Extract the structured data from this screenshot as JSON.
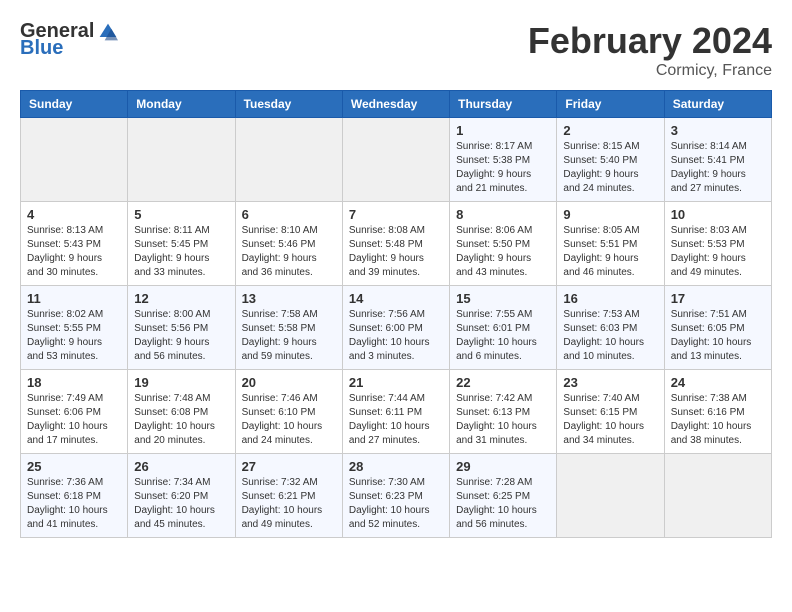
{
  "header": {
    "logo_general": "General",
    "logo_blue": "Blue",
    "month": "February 2024",
    "location": "Cormicy, France"
  },
  "days_of_week": [
    "Sunday",
    "Monday",
    "Tuesday",
    "Wednesday",
    "Thursday",
    "Friday",
    "Saturday"
  ],
  "weeks": [
    [
      {
        "day": "",
        "info": ""
      },
      {
        "day": "",
        "info": ""
      },
      {
        "day": "",
        "info": ""
      },
      {
        "day": "",
        "info": ""
      },
      {
        "day": "1",
        "info": "Sunrise: 8:17 AM\nSunset: 5:38 PM\nDaylight: 9 hours\nand 21 minutes."
      },
      {
        "day": "2",
        "info": "Sunrise: 8:15 AM\nSunset: 5:40 PM\nDaylight: 9 hours\nand 24 minutes."
      },
      {
        "day": "3",
        "info": "Sunrise: 8:14 AM\nSunset: 5:41 PM\nDaylight: 9 hours\nand 27 minutes."
      }
    ],
    [
      {
        "day": "4",
        "info": "Sunrise: 8:13 AM\nSunset: 5:43 PM\nDaylight: 9 hours\nand 30 minutes."
      },
      {
        "day": "5",
        "info": "Sunrise: 8:11 AM\nSunset: 5:45 PM\nDaylight: 9 hours\nand 33 minutes."
      },
      {
        "day": "6",
        "info": "Sunrise: 8:10 AM\nSunset: 5:46 PM\nDaylight: 9 hours\nand 36 minutes."
      },
      {
        "day": "7",
        "info": "Sunrise: 8:08 AM\nSunset: 5:48 PM\nDaylight: 9 hours\nand 39 minutes."
      },
      {
        "day": "8",
        "info": "Sunrise: 8:06 AM\nSunset: 5:50 PM\nDaylight: 9 hours\nand 43 minutes."
      },
      {
        "day": "9",
        "info": "Sunrise: 8:05 AM\nSunset: 5:51 PM\nDaylight: 9 hours\nand 46 minutes."
      },
      {
        "day": "10",
        "info": "Sunrise: 8:03 AM\nSunset: 5:53 PM\nDaylight: 9 hours\nand 49 minutes."
      }
    ],
    [
      {
        "day": "11",
        "info": "Sunrise: 8:02 AM\nSunset: 5:55 PM\nDaylight: 9 hours\nand 53 minutes."
      },
      {
        "day": "12",
        "info": "Sunrise: 8:00 AM\nSunset: 5:56 PM\nDaylight: 9 hours\nand 56 minutes."
      },
      {
        "day": "13",
        "info": "Sunrise: 7:58 AM\nSunset: 5:58 PM\nDaylight: 9 hours\nand 59 minutes."
      },
      {
        "day": "14",
        "info": "Sunrise: 7:56 AM\nSunset: 6:00 PM\nDaylight: 10 hours\nand 3 minutes."
      },
      {
        "day": "15",
        "info": "Sunrise: 7:55 AM\nSunset: 6:01 PM\nDaylight: 10 hours\nand 6 minutes."
      },
      {
        "day": "16",
        "info": "Sunrise: 7:53 AM\nSunset: 6:03 PM\nDaylight: 10 hours\nand 10 minutes."
      },
      {
        "day": "17",
        "info": "Sunrise: 7:51 AM\nSunset: 6:05 PM\nDaylight: 10 hours\nand 13 minutes."
      }
    ],
    [
      {
        "day": "18",
        "info": "Sunrise: 7:49 AM\nSunset: 6:06 PM\nDaylight: 10 hours\nand 17 minutes."
      },
      {
        "day": "19",
        "info": "Sunrise: 7:48 AM\nSunset: 6:08 PM\nDaylight: 10 hours\nand 20 minutes."
      },
      {
        "day": "20",
        "info": "Sunrise: 7:46 AM\nSunset: 6:10 PM\nDaylight: 10 hours\nand 24 minutes."
      },
      {
        "day": "21",
        "info": "Sunrise: 7:44 AM\nSunset: 6:11 PM\nDaylight: 10 hours\nand 27 minutes."
      },
      {
        "day": "22",
        "info": "Sunrise: 7:42 AM\nSunset: 6:13 PM\nDaylight: 10 hours\nand 31 minutes."
      },
      {
        "day": "23",
        "info": "Sunrise: 7:40 AM\nSunset: 6:15 PM\nDaylight: 10 hours\nand 34 minutes."
      },
      {
        "day": "24",
        "info": "Sunrise: 7:38 AM\nSunset: 6:16 PM\nDaylight: 10 hours\nand 38 minutes."
      }
    ],
    [
      {
        "day": "25",
        "info": "Sunrise: 7:36 AM\nSunset: 6:18 PM\nDaylight: 10 hours\nand 41 minutes."
      },
      {
        "day": "26",
        "info": "Sunrise: 7:34 AM\nSunset: 6:20 PM\nDaylight: 10 hours\nand 45 minutes."
      },
      {
        "day": "27",
        "info": "Sunrise: 7:32 AM\nSunset: 6:21 PM\nDaylight: 10 hours\nand 49 minutes."
      },
      {
        "day": "28",
        "info": "Sunrise: 7:30 AM\nSunset: 6:23 PM\nDaylight: 10 hours\nand 52 minutes."
      },
      {
        "day": "29",
        "info": "Sunrise: 7:28 AM\nSunset: 6:25 PM\nDaylight: 10 hours\nand 56 minutes."
      },
      {
        "day": "",
        "info": ""
      },
      {
        "day": "",
        "info": ""
      }
    ]
  ]
}
